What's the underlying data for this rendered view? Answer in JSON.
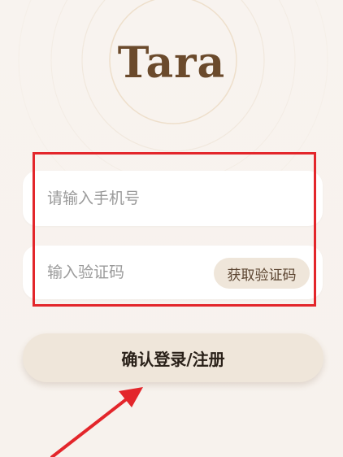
{
  "app": {
    "logo_text": "Tara"
  },
  "login_form": {
    "phone_placeholder": "请输入手机号",
    "code_placeholder": "输入验证码",
    "get_code_label": "获取验证码",
    "submit_label": "确认登录/注册"
  },
  "colors": {
    "brand": "#6b4a2c",
    "button_bg": "#efe6da",
    "highlight": "#e3262b",
    "background": "#f7f2ee"
  },
  "annotations": {
    "highlight_box": "red-rectangle",
    "arrow": "red-arrow-pointing-to-submit"
  }
}
